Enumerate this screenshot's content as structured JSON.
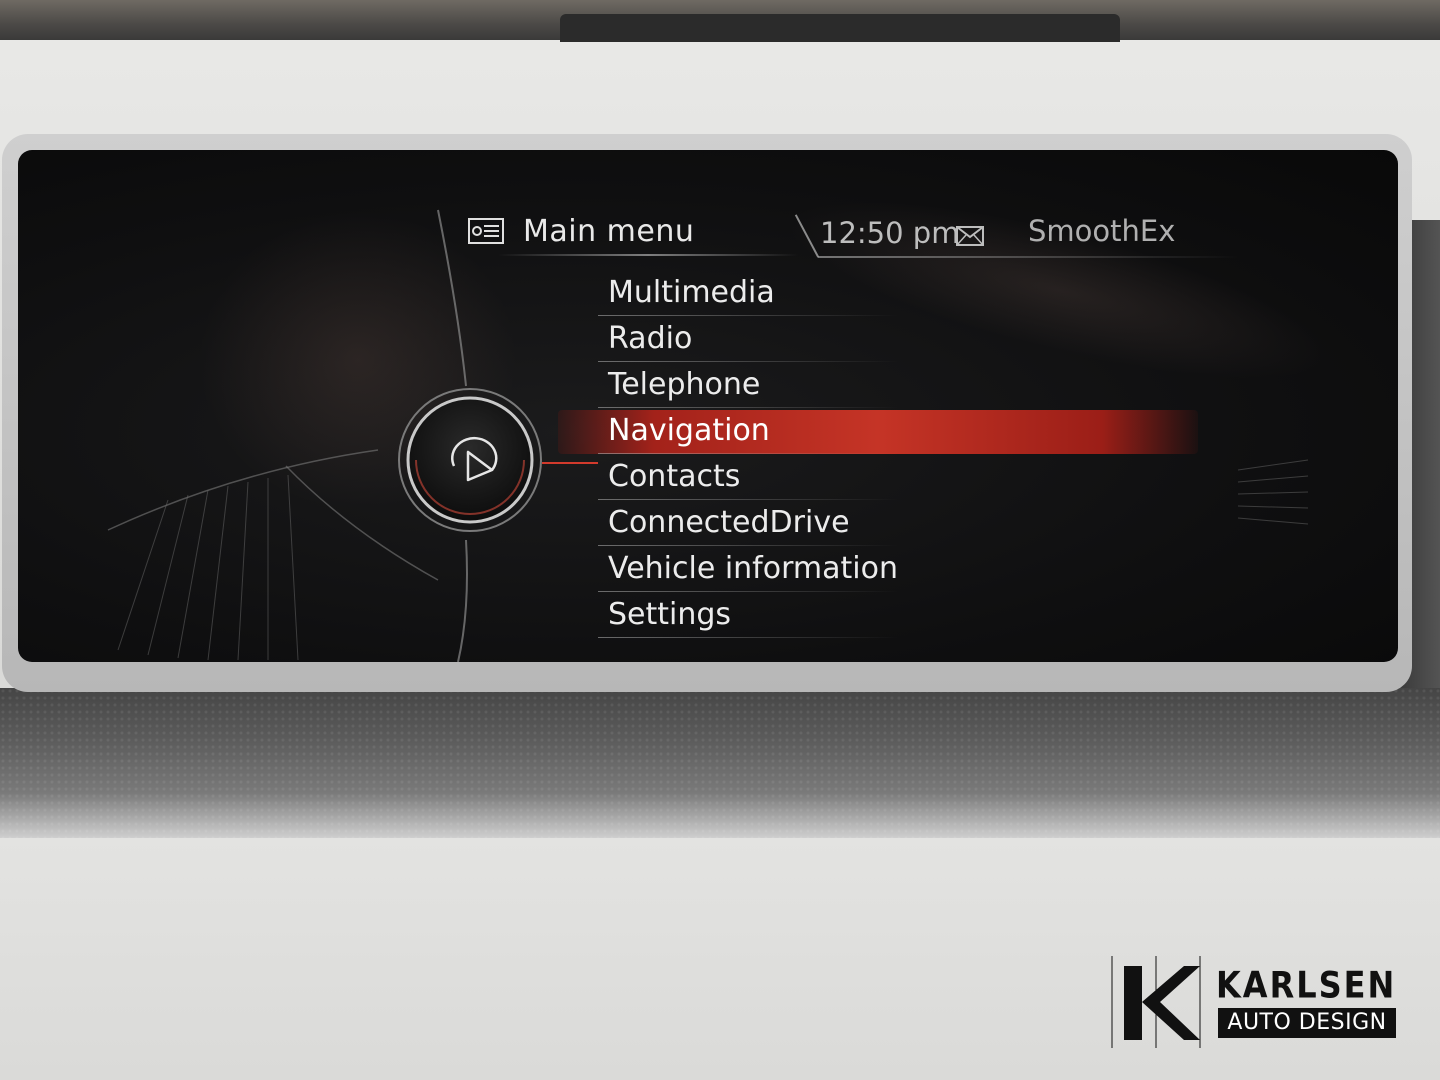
{
  "header": {
    "title": "Main menu",
    "title_icon": "main-menu-icon",
    "time": "12:50 pm",
    "message_icon": "envelope-icon",
    "profile": "SmoothEx"
  },
  "controller_icon": "navigation-arrow-icon",
  "menu": {
    "items": [
      {
        "label": "Multimedia"
      },
      {
        "label": "Radio"
      },
      {
        "label": "Telephone"
      },
      {
        "label": "Navigation"
      },
      {
        "label": "Contacts"
      },
      {
        "label": "ConnectedDrive"
      },
      {
        "label": "Vehicle information"
      },
      {
        "label": "Settings"
      }
    ],
    "selected": "Navigation"
  },
  "colors": {
    "highlight": "#c53426",
    "screen_bg": "#0f0f10",
    "text": "#ececec"
  },
  "watermark": {
    "name": "KARLSEN",
    "sub": "AUTO DESIGN"
  }
}
